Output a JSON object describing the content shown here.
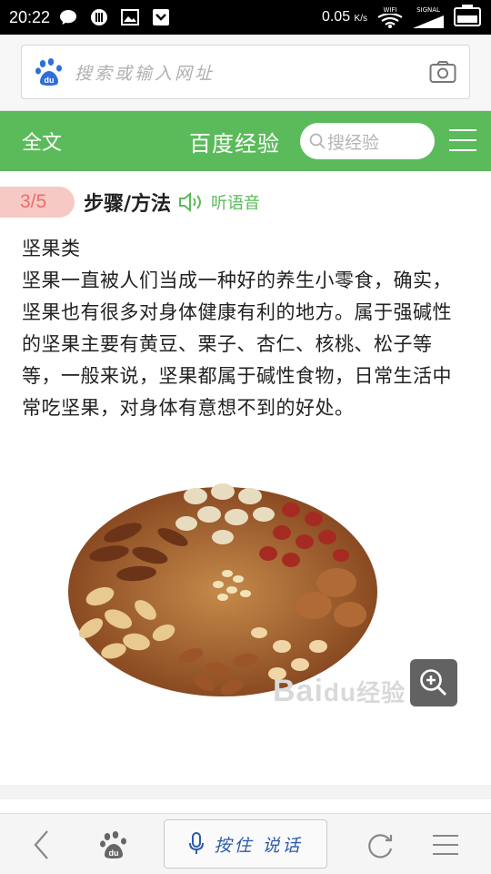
{
  "status_bar": {
    "time": "20:22",
    "speed": "0.05",
    "speed_unit": "K/s",
    "wifi_label": "WIFI",
    "signal_label": "SIGNAL"
  },
  "address_bar": {
    "placeholder": "搜索或输入网址"
  },
  "nav": {
    "left_label": "全文",
    "brand": "百度经验",
    "search_placeholder": "搜经验",
    "accent_color": "#5bbb5b"
  },
  "step": {
    "badge": "3/5",
    "title": "步骤/方法",
    "listen_label": "听语音"
  },
  "content": {
    "heading": "坚果类",
    "paragraph": "坚果一直被人们当成一种好的养生小零食，确实，坚果也有很多对身体健康有利的地方。属于强碱性的坚果主要有黄豆、栗子、杏仁、核桃、松子等等，一般来说，坚果都属于碱性食物，日常生活中常吃坚果，对身体有意想不到的好处。"
  },
  "figure": {
    "watermark": "Bai",
    "watermark_du": "du",
    "watermark_suffix": "经验"
  },
  "toolbar": {
    "voice_label": "按住 说话"
  }
}
